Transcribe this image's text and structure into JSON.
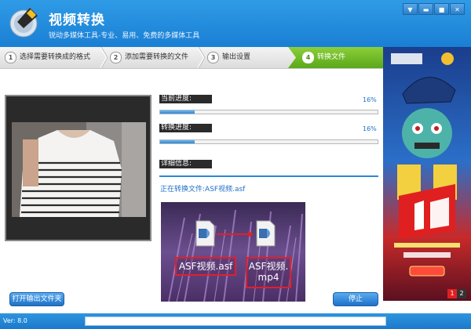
{
  "window": {
    "title": "视频转换",
    "subtitle": "锐动多媒体工具-专业、易用、免费的多媒体工具",
    "controls": [
      "menu-icon",
      "minimize-icon",
      "maximize-icon",
      "close-icon"
    ]
  },
  "steps": [
    {
      "num": "1",
      "label": "选择需要转换成的格式",
      "active": false
    },
    {
      "num": "2",
      "label": "添加需要转换的文件",
      "active": false
    },
    {
      "num": "3",
      "label": "输出设置",
      "active": false
    },
    {
      "num": "4",
      "label": "转换文件",
      "active": true
    }
  ],
  "progress": {
    "current_label": "当前进度:",
    "current_pct": "16%",
    "current_value": 0.16,
    "total_label": "转换进度:",
    "total_pct": "16%",
    "total_value": 0.16
  },
  "details": {
    "label": "详细信息:",
    "converting_text": "正在转换文件:ASF视频.asf"
  },
  "thumbnail": {
    "source_label": "ASF视频.asf",
    "target_label_line1": "ASF视频.",
    "target_label_line2": "mp4"
  },
  "buttons": {
    "open_output": "打开输出文件夹",
    "stop": "停止"
  },
  "ad": {
    "pages": [
      "1",
      "2"
    ],
    "active_page": "1"
  },
  "status": {
    "version": "Ver: 8.0"
  },
  "colors": {
    "title_bar": "#1a7fd4",
    "active_step": "#6ab827",
    "progress": "#2f87d6",
    "accent_text": "#1e6fc8"
  }
}
